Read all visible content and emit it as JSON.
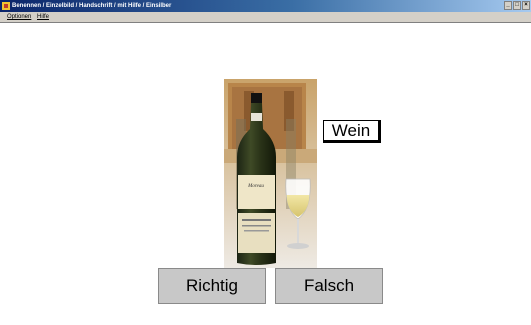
{
  "window": {
    "title": "Benennen / Einzelbild / Handschrift / mit Hilfe / Einsilber",
    "buttons": [
      "minimize-icon",
      "maximize-icon",
      "close-icon"
    ]
  },
  "menu": {
    "items": [
      {
        "label": "Optionen"
      },
      {
        "label": "Hilfe"
      }
    ]
  },
  "exercise": {
    "image": "wine-bottle-and-glass",
    "word": "Wein"
  },
  "answers": {
    "right_label": "Richtig",
    "wrong_label": "Falsch"
  }
}
